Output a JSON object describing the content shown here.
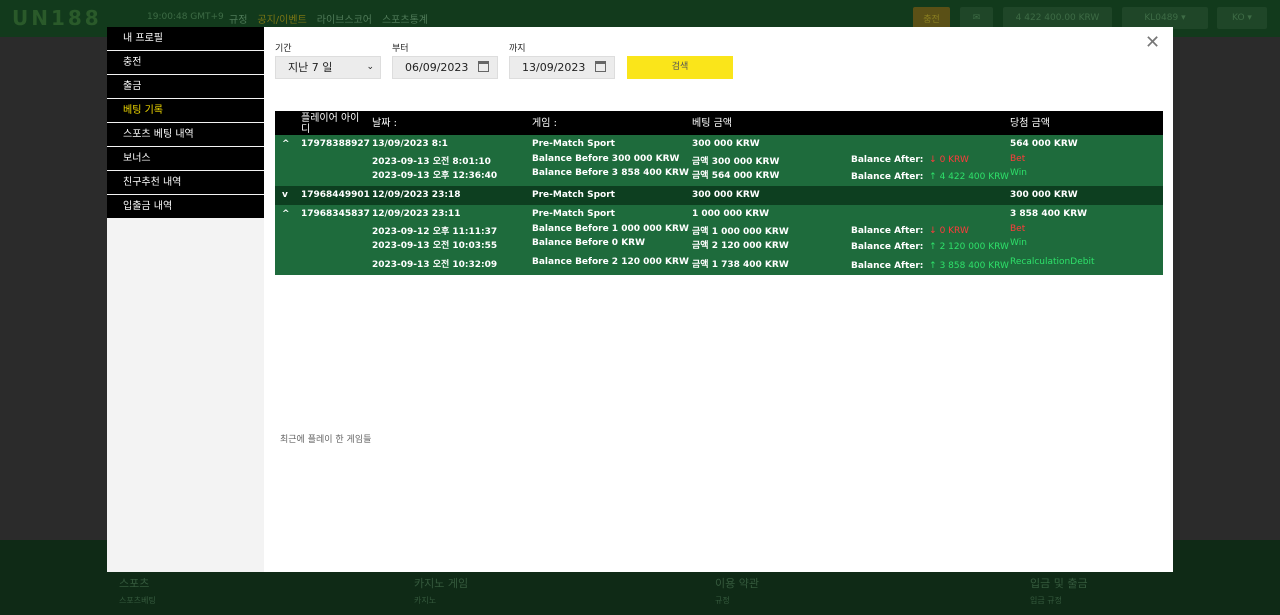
{
  "header": {
    "logo": "UN188",
    "clock": "19:00:48 GMT+9",
    "nav": [
      "규정",
      "공지/이벤트",
      "라이브스코어",
      "스포츠통계"
    ],
    "charge_label": "충전",
    "balance": "4 422 400.00 KRW",
    "username": "KL0489",
    "lang": "KO"
  },
  "sidebar": {
    "items": [
      {
        "label": "내 프로필"
      },
      {
        "label": "충전"
      },
      {
        "label": "출금"
      },
      {
        "label": "베팅 기록"
      },
      {
        "label": "스포츠 베팅 내역"
      },
      {
        "label": "보너스"
      },
      {
        "label": "친구추천 내역"
      },
      {
        "label": "입출금 내역"
      }
    ]
  },
  "filters": {
    "period_label": "기간",
    "period_value": "지난 7 일",
    "from_label": "부터",
    "from_value": "06/09/2023",
    "to_label": "까지",
    "to_value": "13/09/2023",
    "search_label": "검색"
  },
  "table": {
    "headers": {
      "player_id": "플레이어 아이디",
      "date": "날짜 :",
      "game": "게임 :",
      "bet_amount": "베팅 금액",
      "win_amount": "당첨 금액"
    },
    "rows": [
      {
        "toggle": "^",
        "id": "17978388927",
        "date": "13/09/2023 8:1",
        "game": "Pre-Match Sport",
        "bet": "300 000 KRW",
        "win": "564 000 KRW",
        "details": [
          {
            "time": "2023-09-13 오전 8:01:10",
            "before": "Balance Before 300 000 KRW",
            "amount": "금액 300 000 KRW",
            "after_label": "Balance After:",
            "after_value": "0 KRW",
            "type": "Bet"
          },
          {
            "time": "2023-09-13 오후 12:36:40",
            "before": "Balance Before 3 858 400 KRW",
            "amount": "금액 564 000 KRW",
            "after_label": "Balance After:",
            "after_value": "4 422 400 KRW",
            "type": "Win"
          }
        ]
      },
      {
        "toggle": "v",
        "id": "17968449901",
        "date": "12/09/2023 23:18",
        "game": "Pre-Match Sport",
        "bet": "300 000 KRW",
        "win": "300 000 KRW"
      },
      {
        "toggle": "^",
        "id": "17968345837",
        "date": "12/09/2023 23:11",
        "game": "Pre-Match Sport",
        "bet": "1 000 000 KRW",
        "win": "3 858 400 KRW",
        "details": [
          {
            "time": "2023-09-12 오후 11:11:37",
            "before": "Balance Before 1 000 000 KRW",
            "amount": "금액 1 000 000 KRW",
            "after_label": "Balance After:",
            "after_value": "0 KRW",
            "type": "Bet"
          },
          {
            "time": "2023-09-13 오전 10:03:55",
            "before": "Balance Before 0 KRW",
            "amount": "금액 2 120 000 KRW",
            "after_label": "Balance After:",
            "after_value": "2 120 000 KRW",
            "type": "Win"
          },
          {
            "time": "2023-09-13 오전 10:32:09",
            "before": "Balance Before 2 120 000 KRW",
            "amount": "금액 1 738 400 KRW",
            "after_label": "Balance After:",
            "after_value": "3 858 400 KRW",
            "type": "RecalculationDebit"
          }
        ]
      }
    ]
  },
  "recent_games": "최근에 플레이 한 게임들",
  "footer": {
    "cols": [
      {
        "title": "스포츠",
        "sub": "스포츠베팅"
      },
      {
        "title": "카지노 게임",
        "sub": "카지노"
      },
      {
        "title": "이용 약관",
        "sub": "규정"
      },
      {
        "title": "입금 및 출금",
        "sub": "입금 규정"
      }
    ]
  },
  "colors": {
    "row_green": "#1e6b3c",
    "row_dark": "#0d3f20",
    "accent_yellow": "#fae51a",
    "bet_red": "#ff3b3b",
    "win_green": "#2ee06a"
  }
}
